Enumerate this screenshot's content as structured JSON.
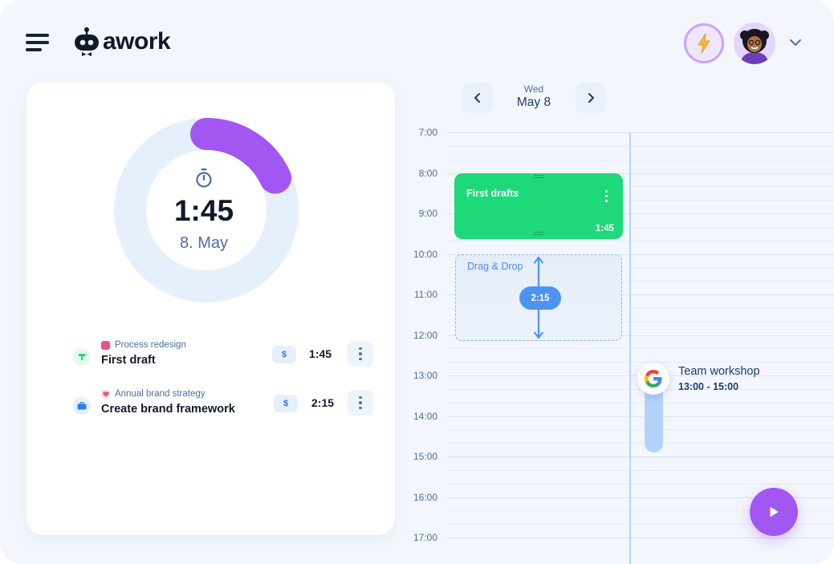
{
  "app": {
    "name": "awork"
  },
  "colors": {
    "accent_purple": "#a256f2",
    "event_green": "#1dd97a",
    "drag_blue": "#4f93f0",
    "text_dark": "#111a2b",
    "text_muted": "#4d6ea5"
  },
  "header": {
    "menu_icon": "hamburger-icon",
    "bolt_icon": "lightning-bolt-icon",
    "avatar": "user-avatar",
    "dropdown_icon": "chevron-down-icon"
  },
  "timer": {
    "icon": "stopwatch-icon",
    "value": "1:45",
    "date": "8. May",
    "progress_fraction": 0.18
  },
  "entries": [
    {
      "project": "Process redesign",
      "title": "First draft",
      "billable_label": "$",
      "duration": "1:45",
      "icon": "task-type-icon",
      "icon_color": "#1dd97a",
      "project_color": "#e8518a"
    },
    {
      "project": "Annual brand strategy",
      "title": "Create brand framework",
      "billable_label": "$",
      "duration": "2:15",
      "icon": "briefcase-icon",
      "icon_color": "#2f7cf0",
      "project_color": "#e8518a"
    }
  ],
  "calendar": {
    "day_name": "Wed",
    "day_date": "May 8",
    "prev_icon": "chevron-left-icon",
    "next_icon": "chevron-right-icon",
    "hours": [
      "7:00",
      "8:00",
      "9:00",
      "10:00",
      "11:00",
      "12:00",
      "13:00",
      "14:00",
      "15:00",
      "16:00",
      "17:00"
    ],
    "events": {
      "green": {
        "title": "First drafts",
        "duration": "1:45"
      },
      "drag": {
        "title": "Drag & Drop",
        "duration": "2:15"
      },
      "google": {
        "title": "Team workshop",
        "time": "13:00 - 15:00",
        "icon": "google-icon"
      }
    }
  },
  "play_icon": "play-icon"
}
